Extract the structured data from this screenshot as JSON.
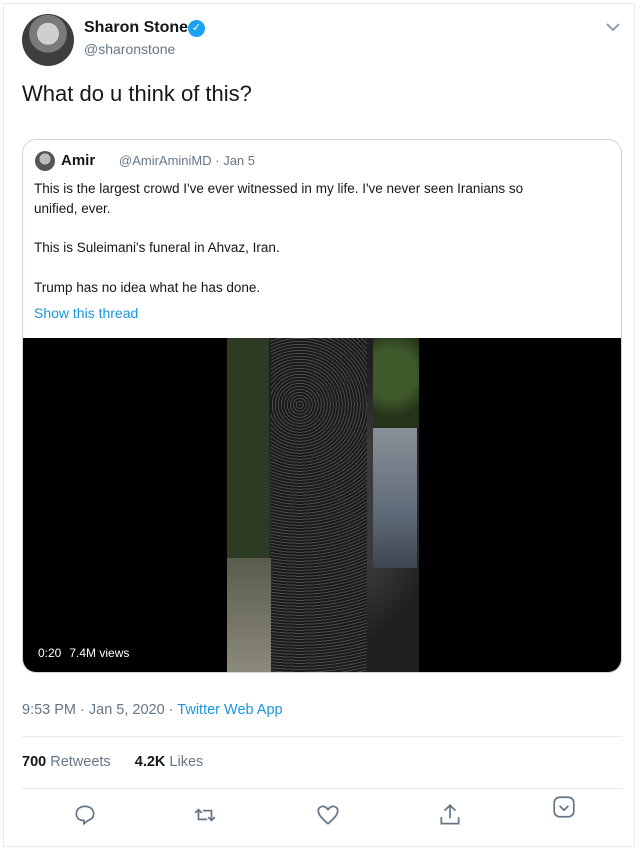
{
  "tweet": {
    "author_name": "Sharon Stone",
    "author_handle": "@sharonstone",
    "text": "What do u think of this?",
    "timestamp": "9:53 PM · Jan 5, 2020",
    "timestamp_sep": " · ",
    "source_app": "Twitter Web App",
    "retweets_count": "700",
    "retweets_label": "Retweets",
    "likes_count": "4.2K",
    "likes_label": "Likes"
  },
  "quoted": {
    "author_name": "Amir",
    "author_handle": "@AmirAminiMD · Jan 5",
    "lines": [
      "This is the largest crowd I've ever witnessed in my life. I've never seen Iranians so",
      "unified, ever.",
      "This is Suleimani's funeral in Ahvaz, Iran.",
      "Trump has no idea what he has done."
    ],
    "show_thread": "Show this thread",
    "video_duration": "0:20",
    "video_views": "7.4M views"
  },
  "icons": {
    "verified": "verified-badge-icon",
    "caret": "chevron-down-icon",
    "reply": "reply-icon",
    "retweet": "retweet-icon",
    "like": "heart-icon",
    "share": "share-icon",
    "analytics": "analytics-icon"
  },
  "colors": {
    "link": "#1b95e0",
    "verified": "#1da1f2",
    "muted": "#657786"
  }
}
